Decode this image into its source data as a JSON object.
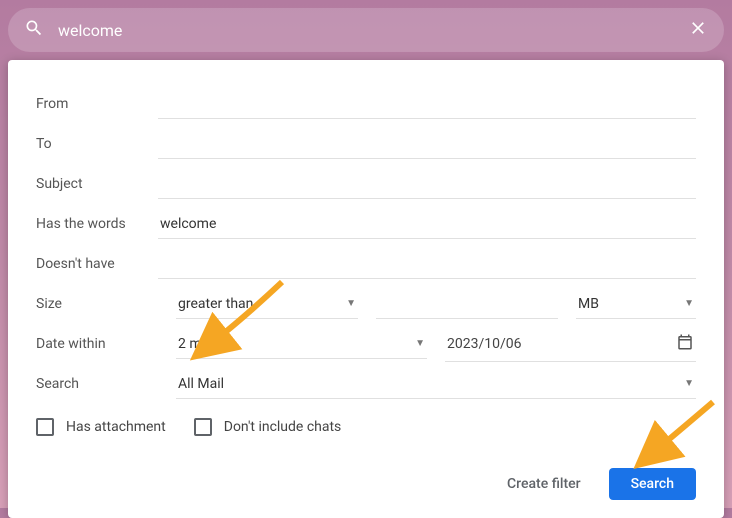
{
  "search": {
    "query": "welcome"
  },
  "panel": {
    "from": {
      "label": "From",
      "value": ""
    },
    "to": {
      "label": "To",
      "value": ""
    },
    "subject": {
      "label": "Subject",
      "value": ""
    },
    "hasWords": {
      "label": "Has the words",
      "value": "welcome"
    },
    "doesntHave": {
      "label": "Doesn't have",
      "value": ""
    },
    "size": {
      "label": "Size",
      "operator": "greater than",
      "value": "",
      "unit": "MB"
    },
    "dateWithin": {
      "label": "Date within",
      "range": "2 months",
      "date": "2023/10/06"
    },
    "searchIn": {
      "label": "Search",
      "scope": "All Mail"
    },
    "hasAttachment": {
      "label": "Has attachment",
      "checked": false
    },
    "dontIncludeChats": {
      "label": "Don't include chats",
      "checked": false
    },
    "createFilter": "Create filter",
    "searchButton": "Search"
  }
}
